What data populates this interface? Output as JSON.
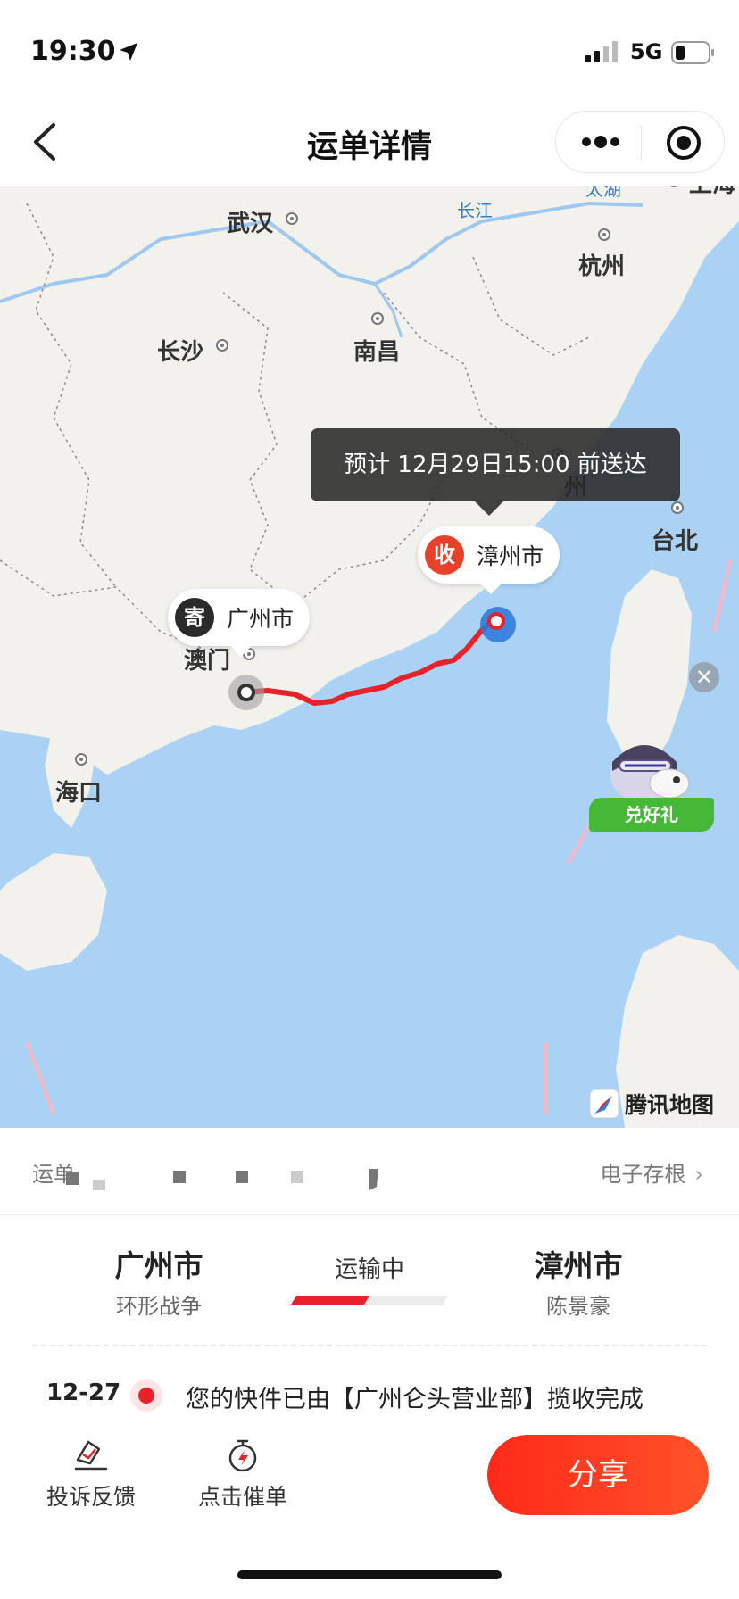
{
  "status_bar": {
    "time": "19:30",
    "network": "5G"
  },
  "nav": {
    "title": "运单详情"
  },
  "map": {
    "eta_text": "预计 12月29日15:00 前送达",
    "origin": {
      "badge": "寄",
      "city": "广州市"
    },
    "destination": {
      "badge": "收",
      "city": "漳州市"
    },
    "cities": {
      "wuhan": "武汉",
      "changsha": "长沙",
      "nanchang": "南昌",
      "hangzhou": "杭州",
      "shanghai": "上海",
      "macau": "澳门",
      "haikou": "海口",
      "taibei": "台北",
      "fuzhou_partial": "州"
    },
    "water": {
      "taihu": "太湖",
      "changjiang": "长江"
    },
    "promo_label": "兑好礼",
    "close_glyph": "✕",
    "provider": "腾讯地图",
    "colors": {
      "route": "#e8212a",
      "sea": "#a9d2f5",
      "land": "#f2f1ec"
    }
  },
  "waybill": {
    "label": "运单",
    "archive_link": "电子存根",
    "archive_chevron": "›"
  },
  "route": {
    "from_city": "广州市",
    "from_person": "环形战争",
    "status": "运输中",
    "progress": 0.5,
    "to_city": "漳州市",
    "to_person": "陈景豪"
  },
  "latest_event": {
    "date": "12-27",
    "text": "您的快件已由【广州仑头营业部】揽收完成"
  },
  "actions": {
    "complaint": "投诉反馈",
    "urge": "点击催单",
    "share": "分享"
  },
  "icons": {
    "location": "location-arrow-icon",
    "signal": "signal-icon",
    "battery": "battery-icon",
    "back": "back-chevron-icon",
    "more": "more-dots-icon",
    "target": "target-icon",
    "complaint": "feedback-icon",
    "urge": "stopwatch-icon"
  }
}
